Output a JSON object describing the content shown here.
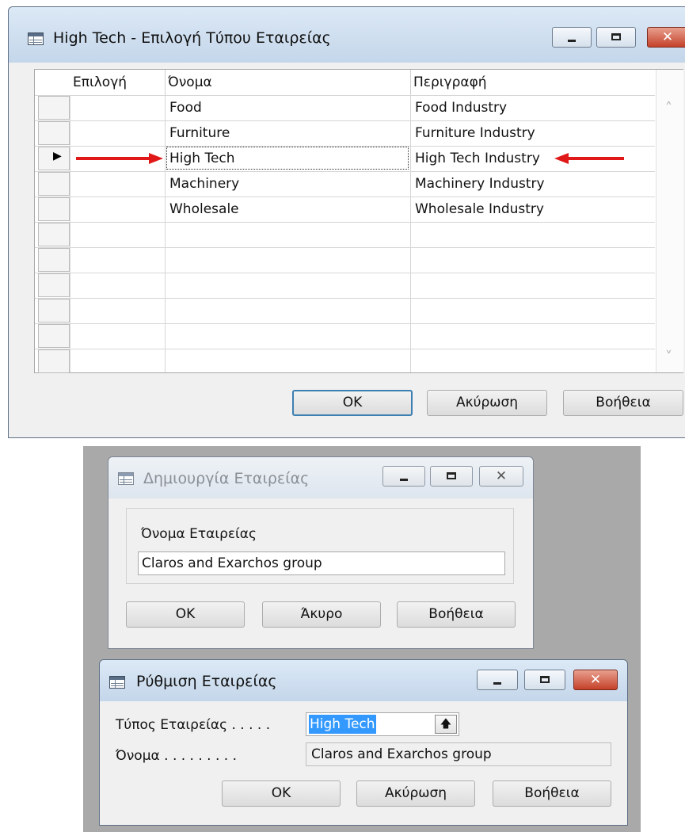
{
  "window1": {
    "title": "High Tech - Επιλογή Τύπου Εταιρείας",
    "columns": [
      "Επιλογή",
      "Όνομα",
      "Περιγραφή"
    ],
    "rows": [
      {
        "name": "Food",
        "description": "Food Industry"
      },
      {
        "name": "Furniture",
        "description": "Furniture Industry"
      },
      {
        "name": "High Tech",
        "description": "High Tech Industry"
      },
      {
        "name": "Machinery",
        "description": "Machinery Industry"
      },
      {
        "name": "Wholesale",
        "description": "Wholesale Industry"
      }
    ],
    "current_row": 2,
    "row_pointer_glyph": "▶",
    "scroll_up_glyph": "˄",
    "scroll_down_glyph": "˅",
    "buttons": {
      "ok": "OK",
      "cancel": "Ακύρωση",
      "help": "Βοήθεια"
    }
  },
  "window2": {
    "title": "Δημιουργία Εταιρείας",
    "field_label": "Όνομα Εταιρείας",
    "field_value": "Claros and Exarchos group",
    "buttons": {
      "ok": "OK",
      "cancel": "Άκυρο",
      "help": "Βοήθεια"
    }
  },
  "window3": {
    "title": "Ρύθμιση Εταιρείας",
    "type_label": "Τύπος Εταιρείας . . . . .",
    "type_value": "High Tech",
    "lookup_glyph": "🡅",
    "name_label": "Όνομα . . . . . . . . .",
    "name_value": "Claros and Exarchos group",
    "buttons": {
      "ok": "OK",
      "cancel": "Ακύρωση",
      "help": "Βοήθεια"
    }
  },
  "window_controls": {
    "minimize": "",
    "maximize": "",
    "close": "✕"
  },
  "colors": {
    "annotation_arrow": "#e01818",
    "selection": "#3399ff",
    "grey_backdrop": "#a9a9a9"
  }
}
